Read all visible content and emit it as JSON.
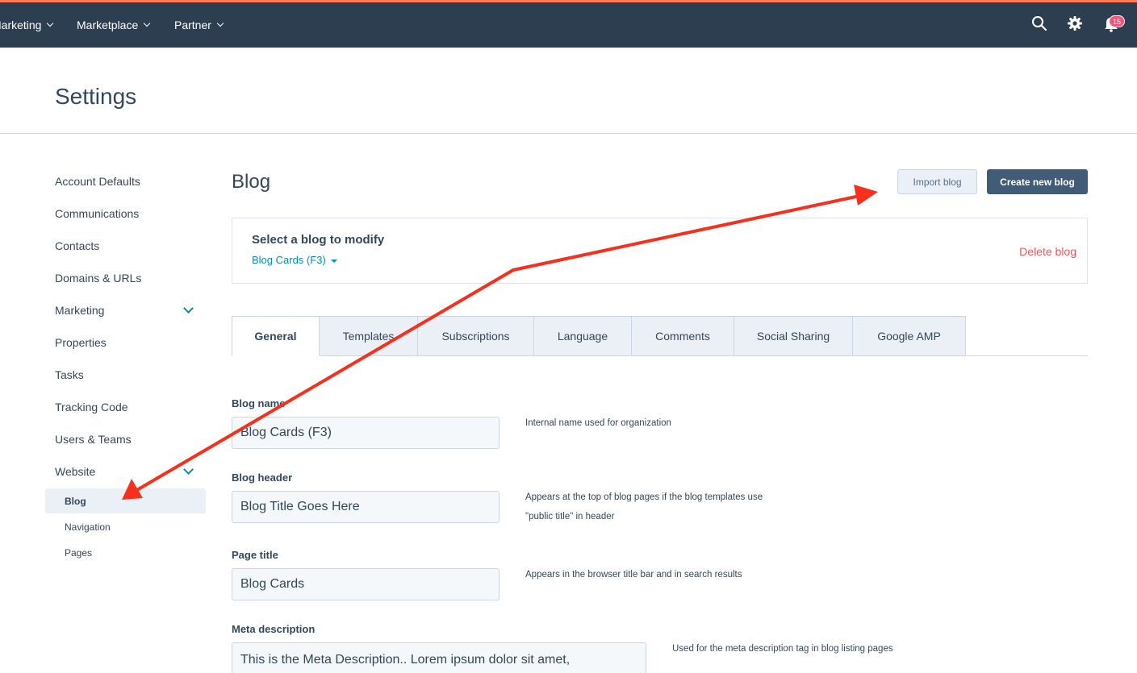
{
  "topbar": {
    "nav": [
      {
        "label": "Marketing"
      },
      {
        "label": "Marketplace"
      },
      {
        "label": "Partner"
      }
    ],
    "notification_count": "15",
    "colors": {
      "bar": "#2d3e50",
      "accent": "#ff7a59",
      "badge": "#f2547d"
    },
    "icons": [
      "search-icon",
      "gear-icon",
      "bell-icon"
    ]
  },
  "page": {
    "title": "Settings"
  },
  "sidebar": {
    "items": [
      {
        "label": "Account Defaults"
      },
      {
        "label": "Communications"
      },
      {
        "label": "Contacts"
      },
      {
        "label": "Domains & URLs"
      },
      {
        "label": "Marketing",
        "expandable": true
      },
      {
        "label": "Properties"
      },
      {
        "label": "Tasks"
      },
      {
        "label": "Tracking Code"
      },
      {
        "label": "Users & Teams"
      },
      {
        "label": "Website",
        "expandable": true
      }
    ],
    "website_children": [
      {
        "label": "Blog",
        "active": true
      },
      {
        "label": "Navigation"
      },
      {
        "label": "Pages"
      }
    ]
  },
  "main": {
    "title": "Blog",
    "import_button": "Import blog",
    "create_button": "Create new blog",
    "select_heading": "Select a blog to modify",
    "selected_blog": "Blog Cards (F3)",
    "delete_link": "Delete blog",
    "tabs": [
      {
        "label": "General",
        "active": true
      },
      {
        "label": "Templates"
      },
      {
        "label": "Subscriptions"
      },
      {
        "label": "Language"
      },
      {
        "label": "Comments"
      },
      {
        "label": "Social Sharing"
      },
      {
        "label": "Google AMP"
      }
    ],
    "fields": {
      "blog_name": {
        "label": "Blog name",
        "value": "Blog Cards (F3)",
        "help": "Internal name used for organization"
      },
      "blog_header": {
        "label": "Blog header",
        "value": "Blog Title Goes Here",
        "help_line1": "Appears at the top of blog pages if the blog templates use",
        "help_line2": "\"public title\" in header"
      },
      "page_title": {
        "label": "Page title",
        "value": "Blog Cards",
        "help": "Appears in the browser title bar and in search results"
      },
      "meta_description": {
        "label": "Meta description",
        "value": "This is the Meta Description.. Lorem ipsum dolor sit amet,",
        "help": "Used for the meta description tag in blog listing pages"
      }
    },
    "colors": {
      "link": "#0091ae",
      "danger": "#f2545b",
      "primary_button": "#425b76",
      "annotation_arrow": "#f5301c"
    }
  }
}
